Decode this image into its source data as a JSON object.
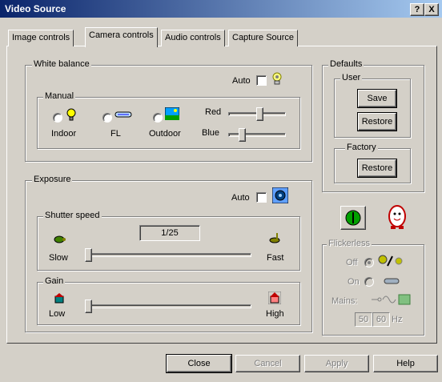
{
  "window": {
    "title": "Video Source",
    "help_glyph": "?",
    "close_glyph": "X"
  },
  "tabs": [
    {
      "label": "Image controls",
      "active": false
    },
    {
      "label": "Camera controls",
      "active": true
    },
    {
      "label": "Audio controls",
      "active": false
    },
    {
      "label": "Capture Source",
      "active": false
    }
  ],
  "white_balance": {
    "group_label": "White balance",
    "auto_label": "Auto",
    "auto_checked": false,
    "manual_label": "Manual",
    "options": [
      {
        "label": "Indoor",
        "icon": "bulb-icon"
      },
      {
        "label": "FL",
        "icon": "fluorescent-tube-icon"
      },
      {
        "label": "Outdoor",
        "icon": "outdoor-landscape-icon"
      }
    ],
    "red_label": "Red",
    "red_level": 0.55,
    "blue_label": "Blue",
    "blue_level": 0.2
  },
  "defaults": {
    "group_label": "Defaults",
    "user_label": "User",
    "save_label": "Save",
    "restore_label": "Restore",
    "factory_label": "Factory",
    "factory_restore_label": "Restore"
  },
  "exposure": {
    "group_label": "Exposure",
    "auto_label": "Auto",
    "auto_checked": false,
    "shutter_label": "Shutter speed",
    "shutter_value": "1/25",
    "slow_label": "Slow",
    "fast_label": "Fast",
    "shutter_level": 0.0,
    "gain_label": "Gain",
    "low_label": "Low",
    "high_label": "High",
    "gain_level": 0.0
  },
  "flickerless": {
    "group_label": "Flickerless",
    "off_label": "Off",
    "on_label": "On",
    "mains_label": "Mains:",
    "hz50": "50",
    "hz60": "60",
    "hz_unit": "Hz",
    "selected": "off"
  },
  "buttons": {
    "close": "Close",
    "cancel": "Cancel",
    "apply": "Apply",
    "help": "Help"
  },
  "colors": {
    "titlebar": "#0a246a",
    "face": "#d4d0c8"
  }
}
